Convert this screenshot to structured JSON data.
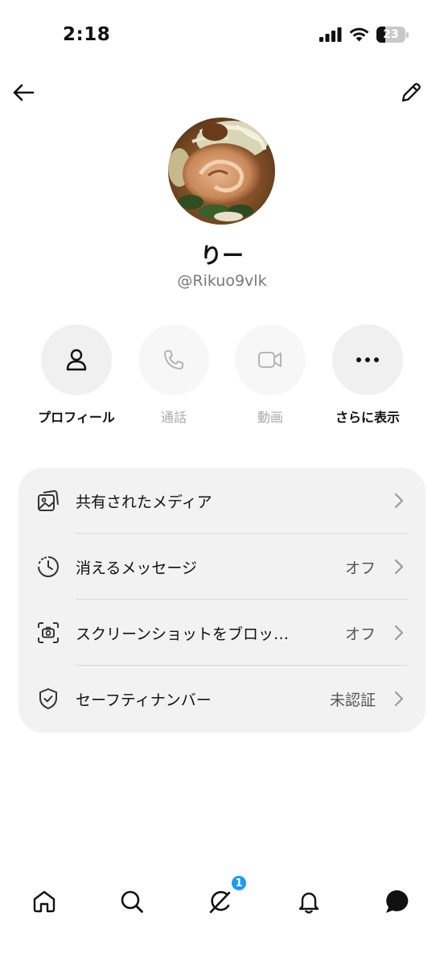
{
  "status_bar": {
    "time": "2:18",
    "battery_level": "23",
    "icons": [
      "signal-icon",
      "wifi-icon",
      "battery-icon"
    ]
  },
  "header": {
    "back_icon": "arrow-left-icon",
    "edit_icon": "pencil-icon"
  },
  "profile": {
    "name": "りー",
    "handle": "@Rikuo9vlk"
  },
  "actions": [
    {
      "label": "プロフィール",
      "icon": "person-icon",
      "enabled": true
    },
    {
      "label": "通話",
      "icon": "phone-icon",
      "enabled": false
    },
    {
      "label": "動画",
      "icon": "video-icon",
      "enabled": false
    },
    {
      "label": "さらに表示",
      "icon": "more-icon",
      "enabled": true
    }
  ],
  "settings": [
    {
      "label": "共有されたメディア",
      "value": "",
      "icon": "media-icon"
    },
    {
      "label": "消えるメッセージ",
      "value": "オフ",
      "icon": "timer-icon"
    },
    {
      "label": "スクリーンショットをブロッ…",
      "value": "オフ",
      "icon": "screenshot-icon"
    },
    {
      "label": "セーフティナンバー",
      "value": "未認証",
      "icon": "shield-check-icon"
    }
  ],
  "tab_bar": {
    "items": [
      "home-icon",
      "search-icon",
      "grok-icon",
      "bell-icon",
      "messages-icon"
    ],
    "badge": "1"
  },
  "colors": {
    "accent": "#1d9bf0",
    "card_background": "#f2f2f2",
    "text_secondary": "#777777"
  }
}
